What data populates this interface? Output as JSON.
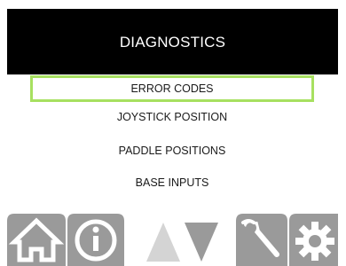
{
  "header": {
    "title": "DIAGNOSTICS"
  },
  "menu": {
    "items": [
      {
        "label": "ERROR CODES",
        "selected": true
      },
      {
        "label": "JOYSTICK POSITION",
        "selected": false
      },
      {
        "label": "PADDLE POSITIONS",
        "selected": false
      },
      {
        "label": "BASE INPUTS",
        "selected": false
      }
    ]
  },
  "toolbar": {
    "buttons": [
      {
        "icon": "home-icon",
        "enabled": true
      },
      {
        "icon": "info-icon",
        "enabled": true
      },
      {
        "icon": "arrow-up-icon",
        "enabled": false
      },
      {
        "icon": "arrow-down-icon",
        "enabled": true
      },
      {
        "icon": "wrench-icon",
        "enabled": true
      },
      {
        "icon": "gear-icon",
        "enabled": true
      }
    ]
  },
  "colors": {
    "header_bg": "#000000",
    "header_text": "#ffffff",
    "selection_border": "#a7e060",
    "button_gray": "#9a9a9a",
    "button_disabled": "#d4d4d4"
  }
}
